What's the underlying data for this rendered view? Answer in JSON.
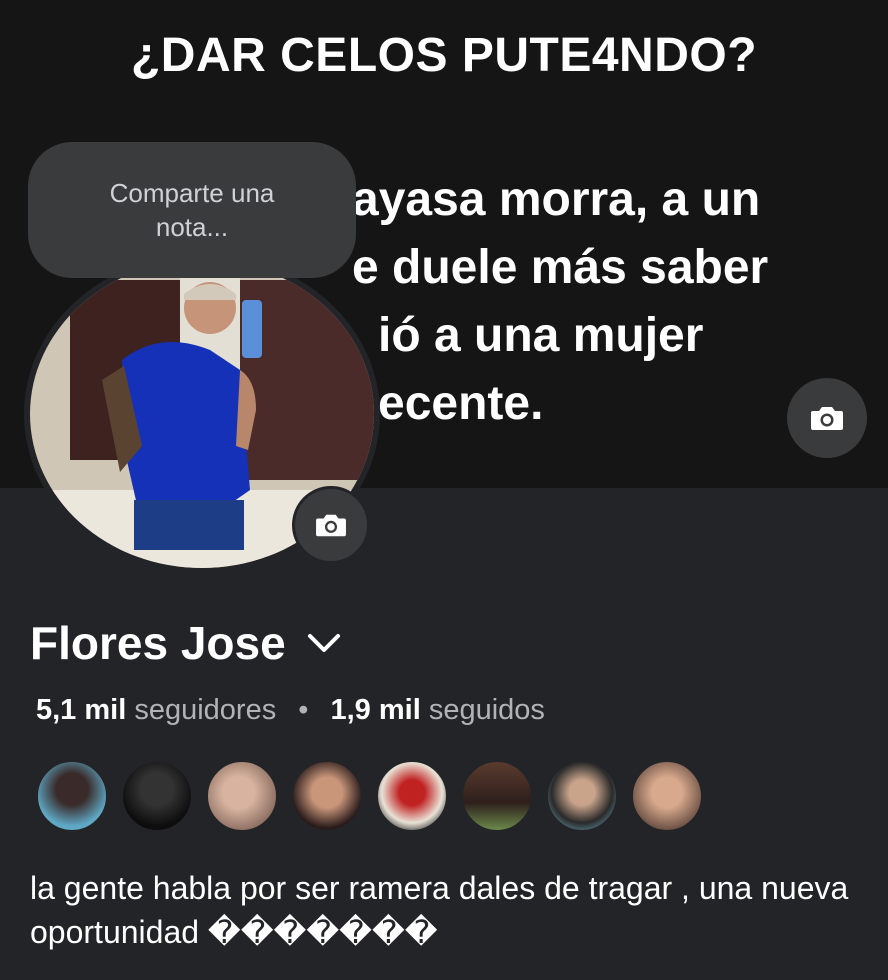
{
  "cover": {
    "title": "¿DAR CELOS PUTE4NDO?",
    "lines": [
      "ayasa morra, a un",
      "e duele más saber",
      "ió a una mujer",
      "ecente."
    ]
  },
  "note": {
    "placeholder": "Comparte una nota..."
  },
  "profile": {
    "name": "Flores Jose",
    "followers_count": "5,1 mil",
    "followers_label": "seguidores",
    "separator": "•",
    "following_count": "1,9 mil",
    "following_label": "seguidos",
    "bio": "la gente habla por ser ramera dales de tragar , una nueva oportunidad �������"
  },
  "icons": {
    "cover_camera": "camera-icon",
    "avatar_camera": "camera-icon",
    "name_dropdown": "chevron-down-icon"
  },
  "colors": {
    "background": "#232427",
    "cover_background": "#151515",
    "button_background": "#3a3b3d",
    "muted_text": "#b0b3b8"
  },
  "friends_count_shown": 8
}
